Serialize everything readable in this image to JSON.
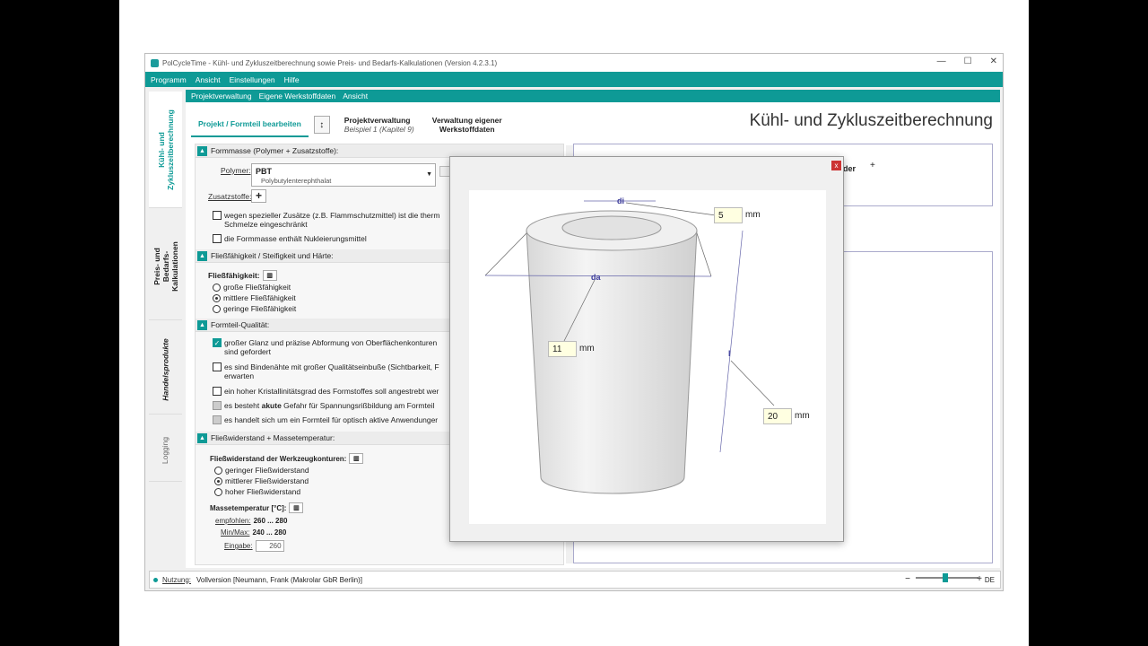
{
  "window": {
    "title": "PolCycleTime - Kühl- und Zykluszeitberechnung sowie Preis- und Bedarfs-Kalkulationen (Version 4.2.3.1)"
  },
  "menu": [
    "Programm",
    "Ansicht",
    "Einstellungen",
    "Hilfe"
  ],
  "submenu": [
    "Projektverwaltung",
    "Eigene Werkstoffdaten",
    "Ansicht"
  ],
  "sidetabs": {
    "kuehl": "Kühl- und Zykluszeitberechnung",
    "preis": "Preis- und Bedarfs-Kalkulationen",
    "handel": "Handelsprodukte",
    "logging": "Logging"
  },
  "tabs": {
    "edit": "Projekt / Formteil bearbeiten",
    "pv_title": "Projektverwaltung",
    "pv_sub": "Beispiel 1 (Kapitel 9)",
    "wd_line1": "Verwaltung eigener",
    "wd_line2": "Werkstoffdaten"
  },
  "main_title": "Kühl- und Zykluszeitberechnung",
  "sec1": {
    "title": "Formmasse (Polymer + Zusatzstoffe):",
    "polymer_label": "Polymer:",
    "polymer": "PBT",
    "polymer_full": "Polybutylenterephthalat",
    "zusatz_label": "Zusatzstoffe:",
    "cb1_a": "wegen spezieller Zusätze (z.B. Flammschutzmittel) ist die therm",
    "cb1_b": "Schmelze eingeschränkt",
    "cb2": "die Formmasse enthält Nukleierungsmittel"
  },
  "sec2": {
    "title": "Fließfähigkeit / Steifigkeit und Härte:",
    "label": "Fließfähigkeit:",
    "o1": "große Fließfähigkeit",
    "o2": "mittlere Fließfähigkeit",
    "o3": "geringe Fließfähigkeit"
  },
  "sec3": {
    "title": "Formteil-Qualität:",
    "c1a": "großer Glanz und präzise Abformung von Oberflächenkonturen",
    "c1b": "sind gefordert",
    "c2a": "es sind Bindenähte mit großer Qualitätseinbuße (Sichtbarkeit, F",
    "c2b": "erwarten",
    "c3": "ein hoher Kristallinitätsgrad des Formstoffes soll angestrebt wer",
    "c4_pre": "es besteht ",
    "c4_b": "akute",
    "c4_post": " Gefahr für Spannungsrißbildung am Formteil",
    "c5": "es handelt sich um ein Formteil für optisch aktive Anwendunger"
  },
  "sec4": {
    "title": "Fließwiderstand + Massetemperatur:",
    "label": "Fließwiderstand der Werkzeugkonturen:",
    "o1": "geringer Fließwiderstand",
    "o2": "mittlerer Fließwiderstand",
    "o3": "hoher Fließwiderstand",
    "mt_label": "Massetemperatur [°C]:",
    "emp_label": "empfohlen:",
    "emp_val": "260 ... 280",
    "mm_label": "Min/Max:",
    "mm_val": "240 ... 280",
    "in_label": "Eingabe:",
    "in_val": "260"
  },
  "right": {
    "partial": "der"
  },
  "popup": {
    "close": "x",
    "di": "di",
    "da": "da",
    "l": "l",
    "di_val": "5",
    "da_val": "11",
    "l_val": "20",
    "unit": "mm"
  },
  "status": {
    "label": "Nutzung:",
    "value": "Vollversion [Neumann, Frank (Makrolar GbR Berlin)]",
    "lang": "DE"
  }
}
